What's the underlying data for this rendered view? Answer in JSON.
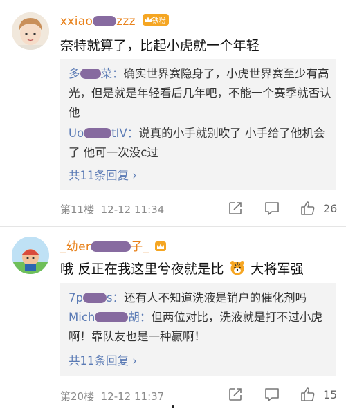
{
  "comments": [
    {
      "username_left": "xxiao",
      "username_right": "zzz",
      "fan_badge": "铁粉",
      "text": "奈特就算了，比起小虎就一个年轻",
      "replies": [
        {
          "name_left": "多",
          "name_right": "菜",
          "text": "确实世界赛隐身了，小虎世界赛至少有高光，但是就是年轻看后几年吧，不能一个赛季就否认他"
        },
        {
          "name_left": "Uo",
          "name_right": "tIV",
          "text": "说真的小手就别吹了 小手给了他机会了 他可一次没c过"
        }
      ],
      "more_replies": "共11条回复 ›",
      "floor": "第11楼",
      "time": "12-12 11:34",
      "likes": "26"
    },
    {
      "username_left": "_幼er",
      "username_right": "子_",
      "text": "哦 反正在我这里兮夜就是比",
      "text_after": "大将军强",
      "replies": [
        {
          "name_left": "7p",
          "name_right": "s",
          "text": "还有人不知道洗液是销户的催化剂吗"
        },
        {
          "name_left": "Mich",
          "name_right": "胡",
          "text": "但两位对比，洗液就是打不过小虎啊！靠队友也是一种赢啊！"
        }
      ],
      "more_replies": "共11条回复 ›",
      "floor": "第20楼",
      "time": "12-12 11:37",
      "likes": "15"
    }
  ],
  "icons": {
    "share": "share-icon",
    "comment": "comment-icon",
    "like": "thumbs-up-icon",
    "emoji": "tiger-emoji",
    "crown": "crown-badge-icon"
  },
  "colors": {
    "username": "#e8811a",
    "reply_name": "#5b7bb5",
    "redaction": "#7a5b96"
  }
}
